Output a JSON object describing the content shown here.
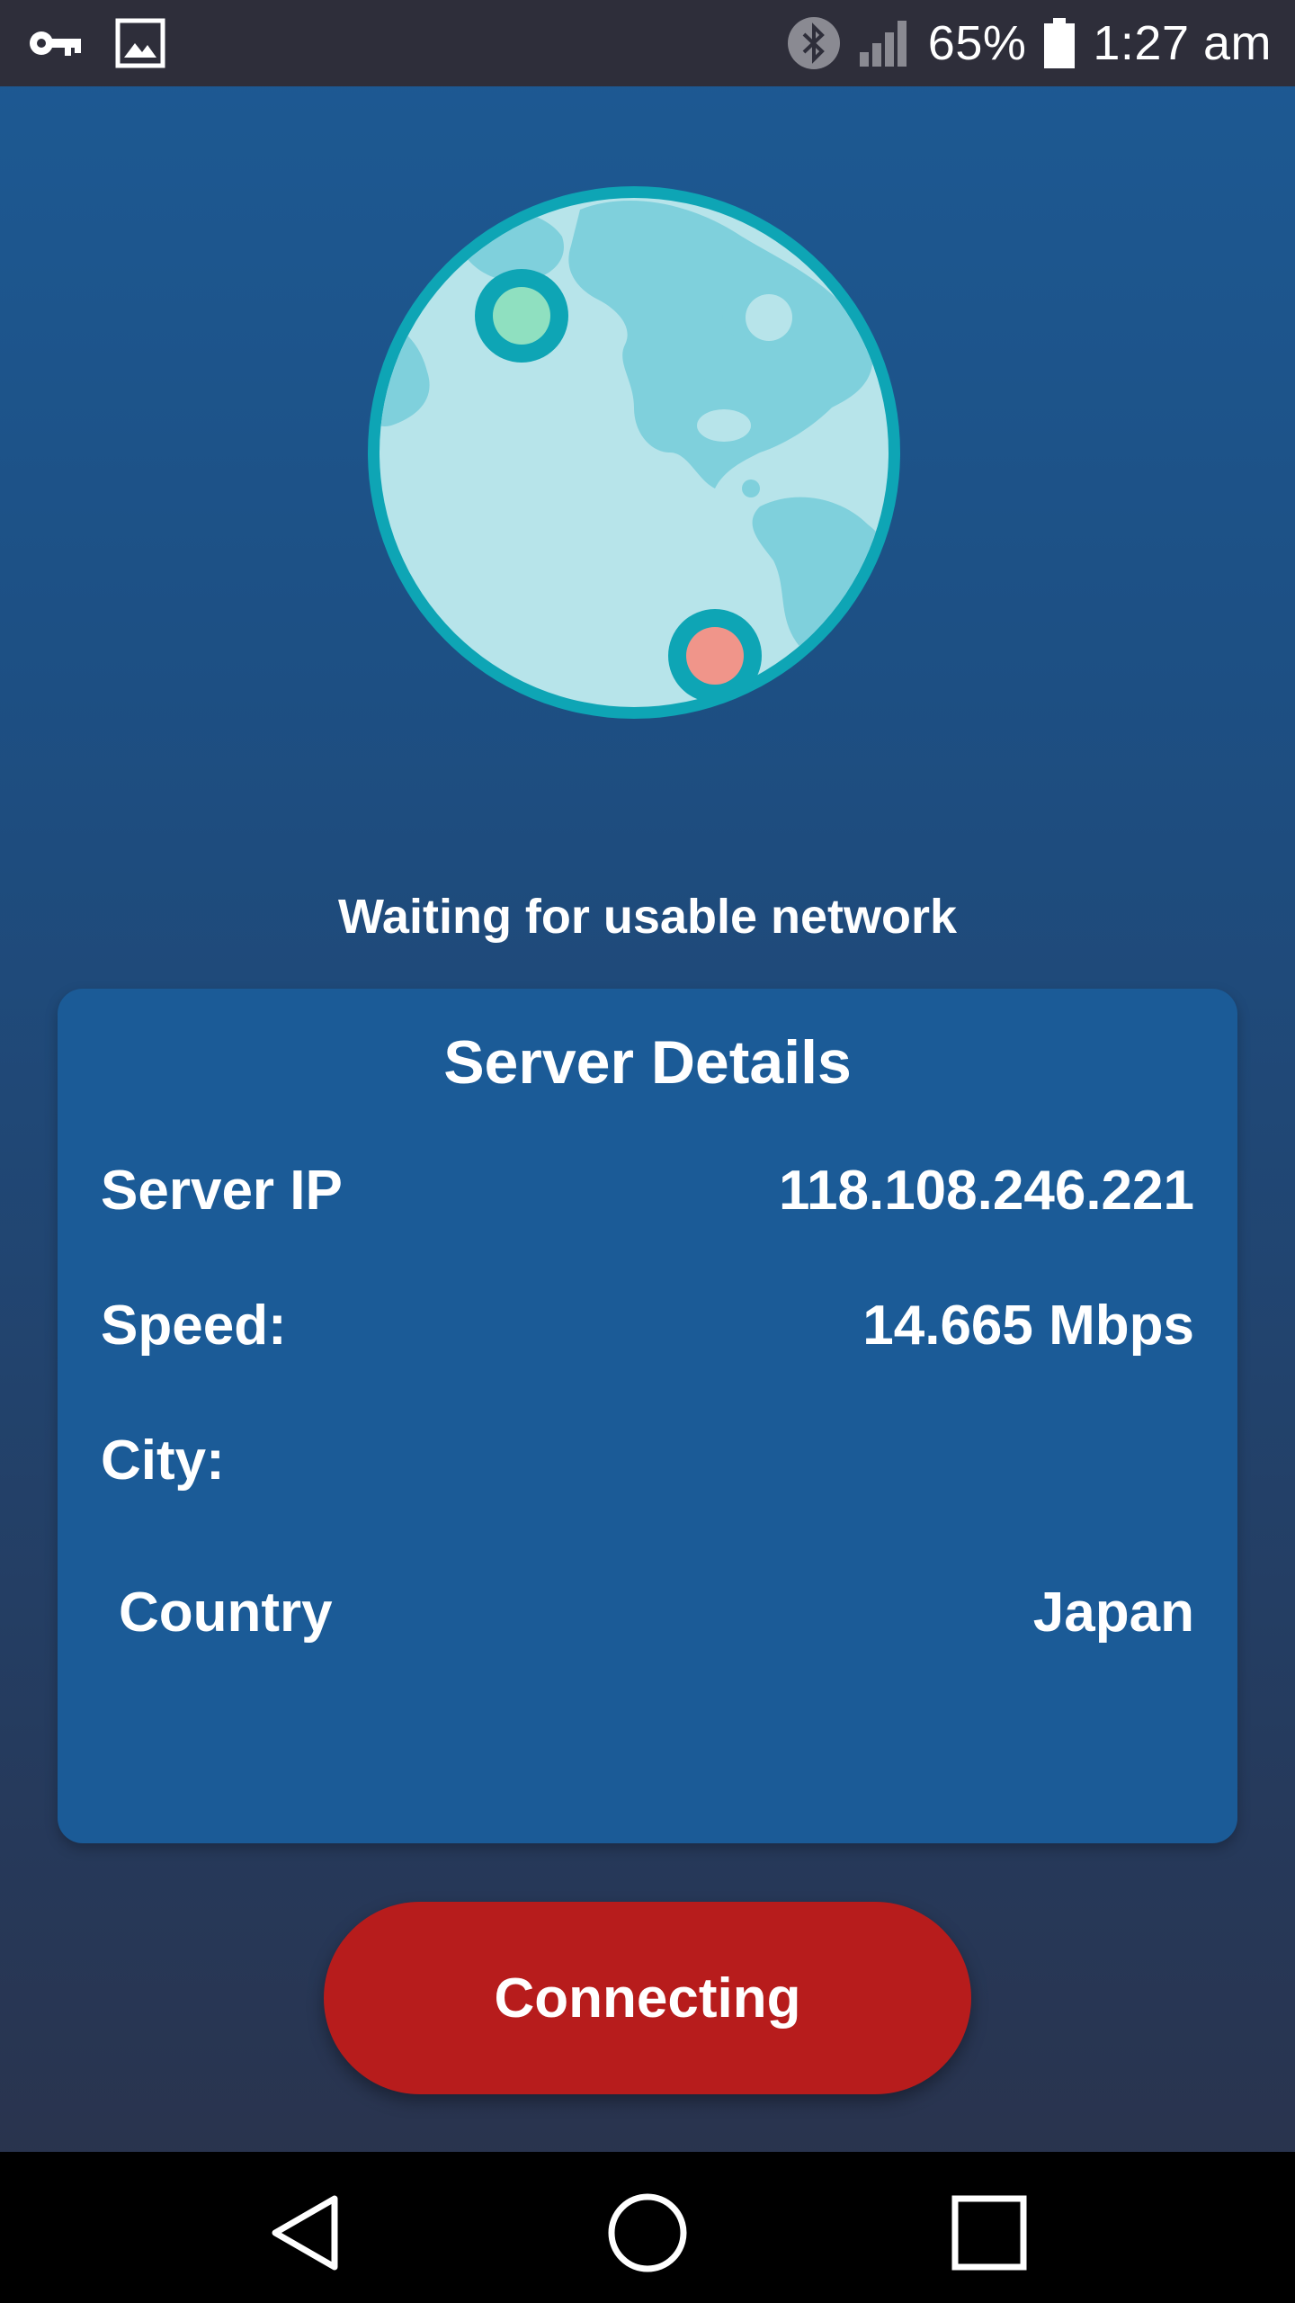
{
  "status_bar": {
    "battery": "65%",
    "time": "1:27 am",
    "icons": [
      "vpn-key-icon",
      "image-icon",
      "bluetooth-icon",
      "signal-icon",
      "battery-icon"
    ]
  },
  "main": {
    "status_message": "Waiting for usable network"
  },
  "server_details": {
    "title": "Server Details",
    "rows": [
      {
        "label": "Server IP",
        "value": "118.108.246.221"
      },
      {
        "label": "Speed:",
        "value": "14.665 Mbps"
      },
      {
        "label": "City:",
        "value": ""
      },
      {
        "label": "Country",
        "value": "Japan"
      }
    ]
  },
  "action": {
    "button_label": "Connecting",
    "button_color": "#b71c1c"
  },
  "navigation": {
    "buttons": [
      "back-icon",
      "home-icon",
      "recents-icon"
    ]
  },
  "colors": {
    "card": "#1b5b97",
    "globe_ring": "#0ea5b5",
    "globe_ocean": "#b7e4ea",
    "globe_land": "#7fd0dc",
    "pin_green": "#8fe0c0",
    "pin_red": "#f0958a"
  }
}
